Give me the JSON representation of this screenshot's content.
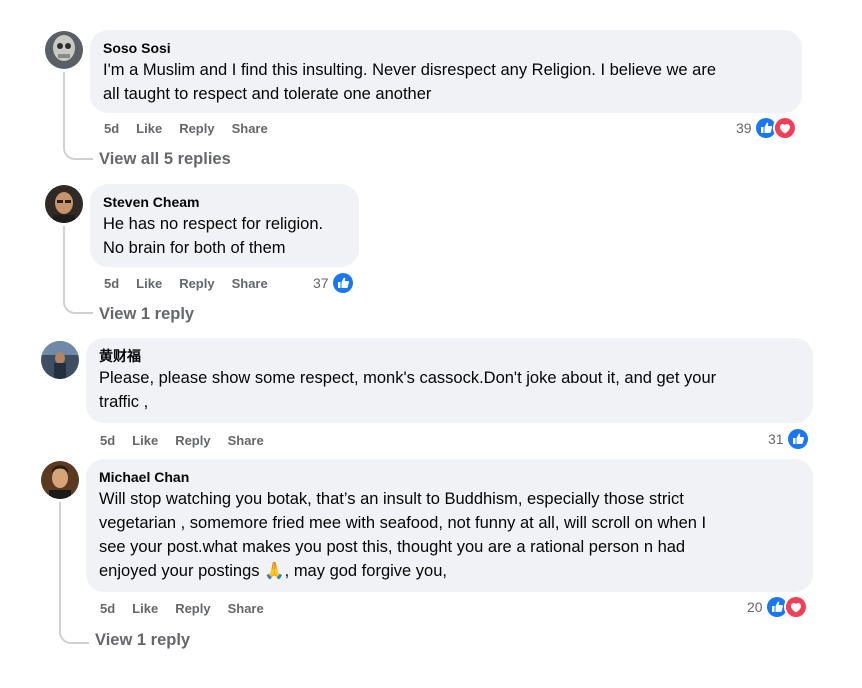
{
  "comments": [
    {
      "author": "Soso Sosi",
      "lines": [
        "I'm a Muslim and I find this insulting. Never disrespect any Religion. I believe we are",
        "all taught to respect and tolerate one another"
      ],
      "time": "5d",
      "like": "Like",
      "reply": "Reply",
      "share": "Share",
      "reaction_count": "39",
      "reactions": [
        "like",
        "love"
      ],
      "view_replies": "View all 5 replies"
    },
    {
      "author": "Steven Cheam",
      "lines": [
        "He has no respect for religion.",
        "No brain for both of them"
      ],
      "time": "5d",
      "like": "Like",
      "reply": "Reply",
      "share": "Share",
      "reaction_count": "37",
      "reactions": [
        "like"
      ],
      "view_replies": "View 1 reply"
    },
    {
      "author": "黄财福",
      "lines": [
        "Please, please show some respect, monk's cassock.Don't joke about it, and get your",
        "traffic ,"
      ],
      "time": "5d",
      "like": "Like",
      "reply": "Reply",
      "share": "Share",
      "reaction_count": "31",
      "reactions": [
        "like"
      ]
    },
    {
      "author": "Michael Chan",
      "lines": [
        "Will stop watching you botak, that’s an insult to Buddhism, especially those strict",
        "vegetarian , somemore fried mee with seafood, not funny at all, will scroll on when I",
        "see your post.what makes you post this, thought you are a rational person n had",
        "enjoyed your postings 🙏, may god forgive you,"
      ],
      "time": "5d",
      "like": "Like",
      "reply": "Reply",
      "share": "Share",
      "reaction_count": "20",
      "reactions": [
        "like",
        "love"
      ],
      "view_replies": "View 1 reply"
    }
  ],
  "colors": {
    "like": "#1877f2",
    "love": "#f33e58",
    "bubble": "#f0f2f5",
    "meta": "#65676b"
  },
  "icons": {
    "like": "thumbs-up-icon",
    "love": "heart-icon"
  }
}
